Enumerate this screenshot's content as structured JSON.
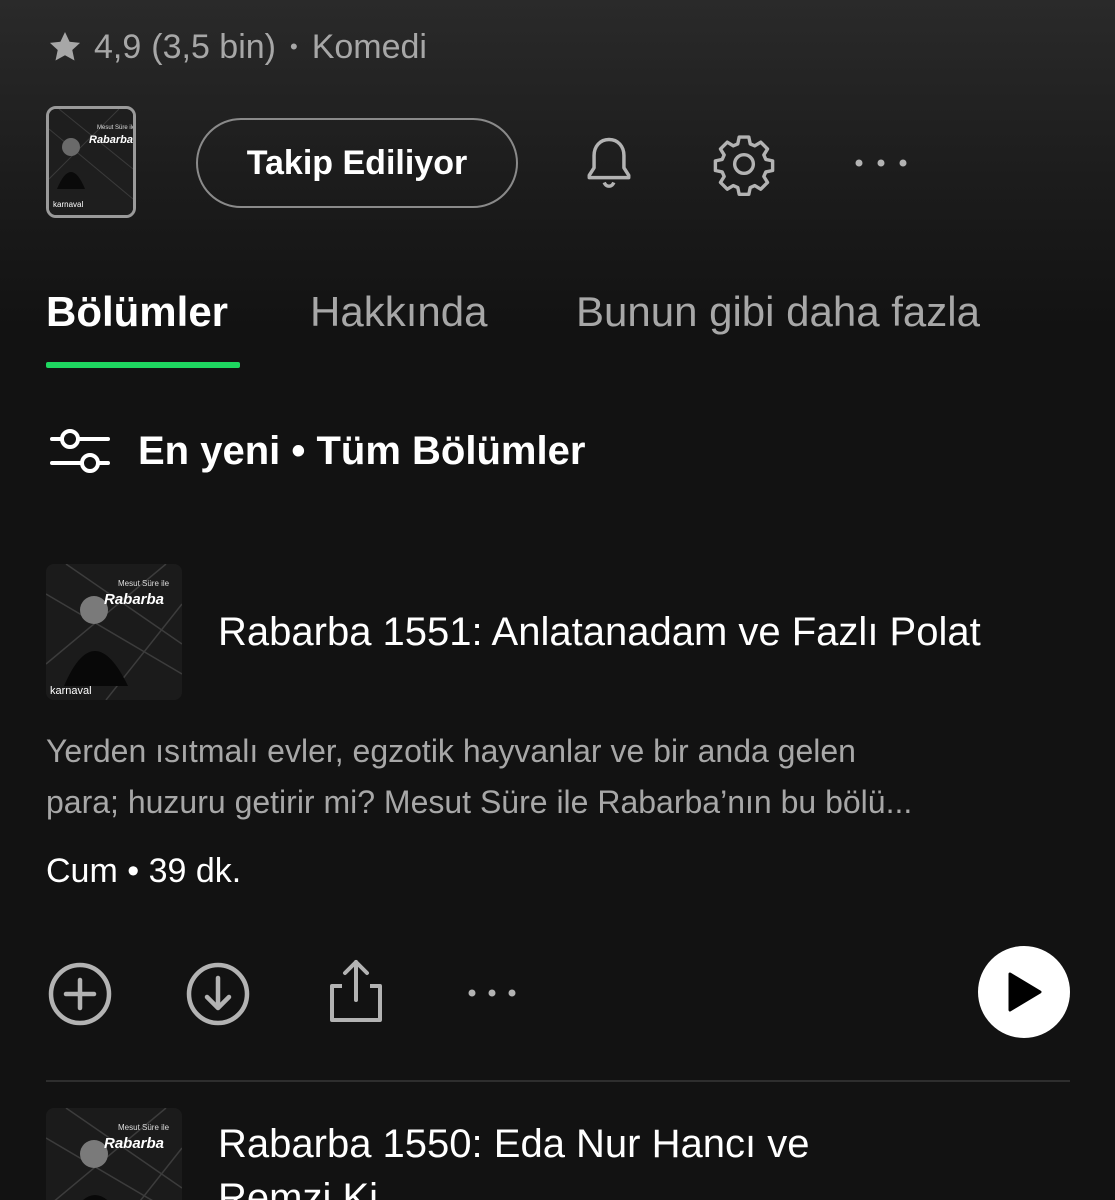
{
  "header": {
    "rating_value": "4,9",
    "rating_count": "(3,5 bin)",
    "separator": "•",
    "category": "Komedi"
  },
  "show_art": {
    "top_text": "Mesut Süre ile",
    "title": "Rabarba",
    "brand": "karnaval"
  },
  "actions": {
    "follow_label": "Takip Ediliyor",
    "icons": [
      "star-icon",
      "bell-icon",
      "gear-icon",
      "more-icon"
    ]
  },
  "tabs": [
    {
      "label": "Bölümler",
      "active": true
    },
    {
      "label": "Hakkında",
      "active": false
    },
    {
      "label": "Bunun gibi daha fazla",
      "active": false
    }
  ],
  "filter": {
    "label": "En yeni • Tüm Bölümler"
  },
  "episodes": [
    {
      "title": "Rabarba 1551: Anlatanadam ve Fazlı Polat",
      "description_line1": "Yerden ısıtmalı evler, egzotik hayvanlar ve bir anda gelen",
      "description_line2": "para; huzuru getirir mi? Mesut Süre ile Rabarba’nın bu bölü...",
      "meta": "Cum • 39 dk."
    },
    {
      "title_line1": "Rabarba 1550: Eda Nur Hancı ve",
      "title_line2": "Remzi Ki..."
    }
  ],
  "colors": {
    "background": "#121212",
    "accent": "#1ed760",
    "text_primary": "#ffffff",
    "text_secondary": "#a7a7a7"
  }
}
